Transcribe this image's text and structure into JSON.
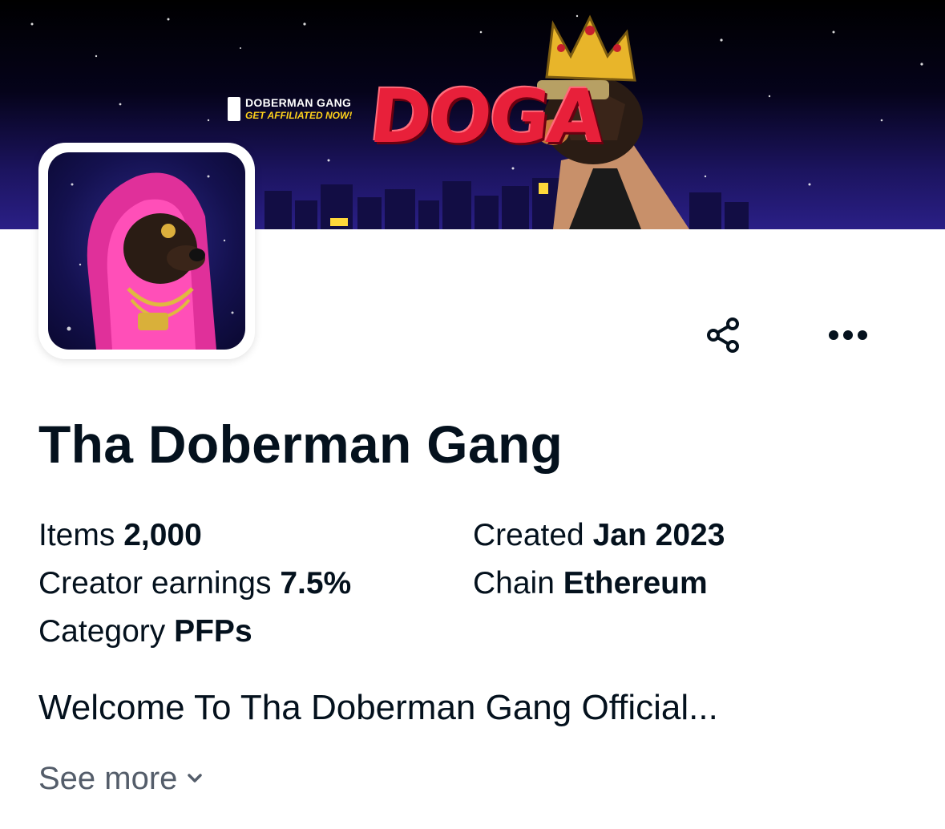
{
  "banner": {
    "brand_name": "DOBERMAN GANG",
    "brand_cta": "GET AFFILIATED NOW!",
    "brand_word": "DOGA"
  },
  "collection": {
    "title": "Tha Doberman Gang",
    "description": "Welcome To Tha Doberman Gang Official...",
    "see_more_label": "See more"
  },
  "stats": {
    "items_label": "Items",
    "items_value": "2,000",
    "earnings_label": "Creator earnings",
    "earnings_value": "7.5%",
    "category_label": "Category",
    "category_value": "PFPs",
    "created_label": "Created",
    "created_value": "Jan 2023",
    "chain_label": "Chain",
    "chain_value": "Ethereum"
  },
  "icons": {
    "share": "share-icon",
    "more": "more-horizontal-icon",
    "chevron": "chevron-down-icon"
  }
}
